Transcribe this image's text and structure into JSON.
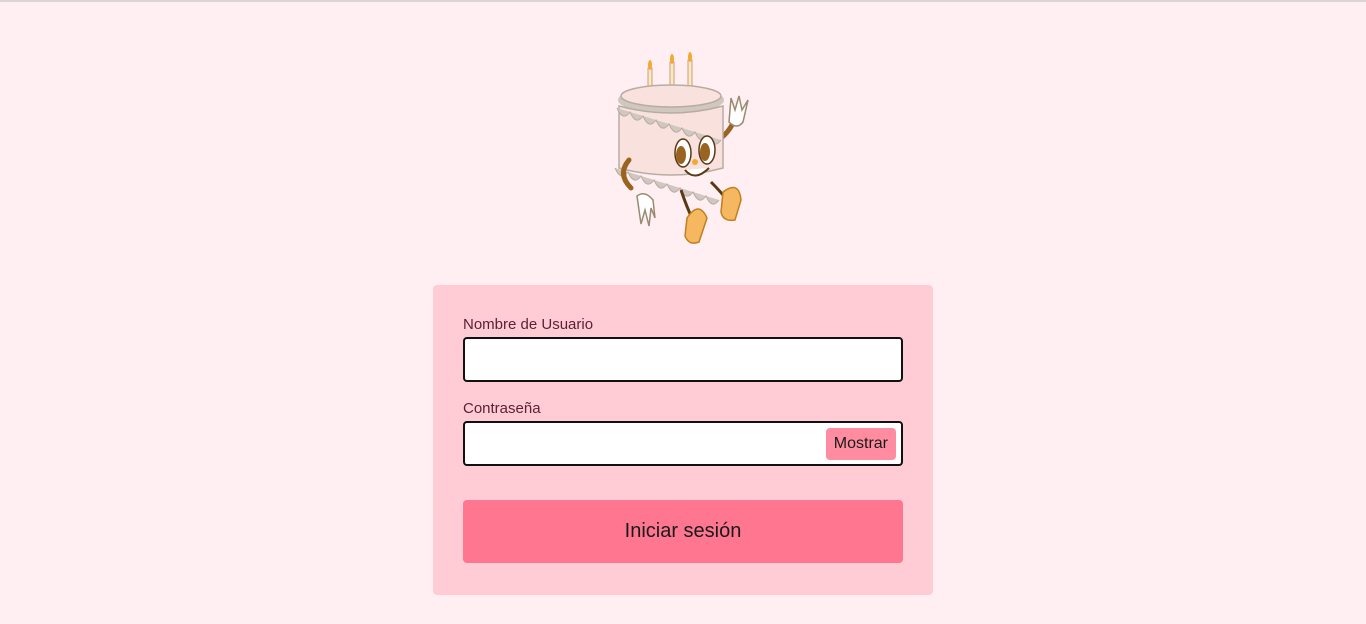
{
  "form": {
    "username_label": "Nombre de Usuario",
    "username_value": "",
    "password_label": "Contraseña",
    "password_value": "",
    "show_label": "Mostrar",
    "submit_label": "Iniciar sesión"
  },
  "theme": {
    "background": "#ffeff3",
    "card": "#ffcbd5",
    "accent": "#ff7690",
    "show_button": "#ff8ca0"
  },
  "mascot": {
    "icon": "birthday-cake-mascot-icon"
  }
}
